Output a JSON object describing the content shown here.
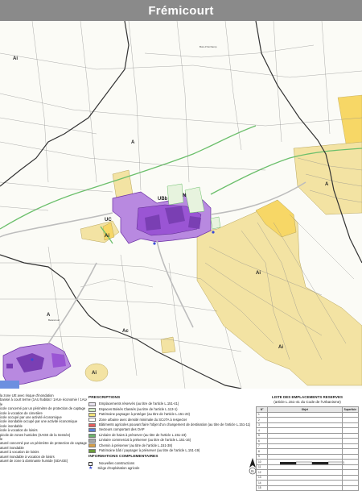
{
  "title": "Frémicourt",
  "map": {
    "zone_labels": [
      "Ai",
      "A",
      "A",
      "Ac",
      "N",
      "UC",
      "UBb",
      "Ai",
      "A",
      "Ai",
      "Ai",
      "Ai"
    ],
    "place_labels": [
      "Bois d'Inrchamp",
      "Belancourt"
    ]
  },
  "legend_left": [
    "la zone UE avec risque d'inondation",
    "banisé à court terme (1AU habitat / 1AUe économie / 1AUéquipements)",
    "le",
    "icole concerné par un périmètre de protection de captage",
    "icole à vocation de cimetière",
    "icole occupé par une activité économique",
    "icole inondable occupé par une activité économique",
    "icole inondable",
    "icole à vocation de loisirs",
    "picole de zones humides (SAGE de la Sensée)",
    "le",
    "aturel concerné par un périmètre de protection de captage",
    "aturel inondable",
    "aturel à vocation de loisirs",
    "aturel inondable à vocation de loisirs",
    "aturel de zone à dominante humide (SDAGE)"
  ],
  "prescriptions": {
    "heading": "PRESCRIPTIONS",
    "items": [
      {
        "label": "Emplacements réservés (au titre de l'article L.151-41)",
        "color": "#e8e2ee"
      },
      {
        "label": "Espaces Boisés Classés (au titre de l'article L.113-1)",
        "color": "#cfe8c2"
      },
      {
        "label": "Patrimoine paysager à protéger (au titre de l'article L.151-23)",
        "color": "#f1e27a"
      },
      {
        "label": "Zone urbaine avec densité minimale du SCoTA à respecter",
        "color": "#ffffff"
      },
      {
        "label": "Bâtiments agricoles pouvant faire l'objet d'un changement de destination (au titre de l'article L.151-11)",
        "color": "#e35d5d"
      },
      {
        "label": "Secteurs comportant des OAP",
        "color": "#5c7fd6"
      },
      {
        "label": "Linéaire de haies à préserver (au titre de l'article L.151-23)",
        "color": "#6db36d"
      },
      {
        "label": "Linéaire commercial à préserver (au titre de l'article L.151-16)",
        "color": "#a8a8a8"
      },
      {
        "label": "Chemin à préserver (au titre de l'article L.151-38)",
        "color": "#d9a14a"
      },
      {
        "label": "Patrimoine bâti / paysager à préserver (au titre de l'article L.151-19)",
        "color": "#6a9a3a"
      }
    ]
  },
  "complementary": {
    "heading": "INFORMATIONS COMPLEMENTAIRES",
    "items": [
      "Nouvelles constructions",
      "Siège d'exploitation agricole"
    ]
  },
  "reserved_list": {
    "title_line1": "LISTE DES EMPLACEMENTS RESERVES",
    "title_line2": "(article L.151-41 du Code de l'Urbanisme)",
    "columns": [
      "N°",
      "Objet",
      "Superficie"
    ],
    "rows": [
      [
        "1",
        "",
        ""
      ],
      [
        "2",
        "",
        ""
      ],
      [
        "3",
        "",
        ""
      ],
      [
        "4",
        "",
        ""
      ],
      [
        "5",
        "",
        ""
      ],
      [
        "6",
        "",
        ""
      ],
      [
        "7",
        "",
        ""
      ],
      [
        "8",
        "",
        ""
      ],
      [
        "9",
        "",
        ""
      ],
      [
        "10",
        "",
        ""
      ],
      [
        "11",
        "",
        ""
      ],
      [
        "12",
        "",
        ""
      ],
      [
        "13",
        "",
        ""
      ],
      [
        "14",
        "",
        ""
      ],
      [
        "15",
        "",
        ""
      ]
    ]
  },
  "colors": {
    "agri_yellow": "#f3e3a3",
    "dense_yellow": "#f7d766",
    "urban_purple": "#b889e0",
    "urban_dark": "#7a3fb3",
    "green_line": "#6bbf6b",
    "boundary": "#333333"
  }
}
